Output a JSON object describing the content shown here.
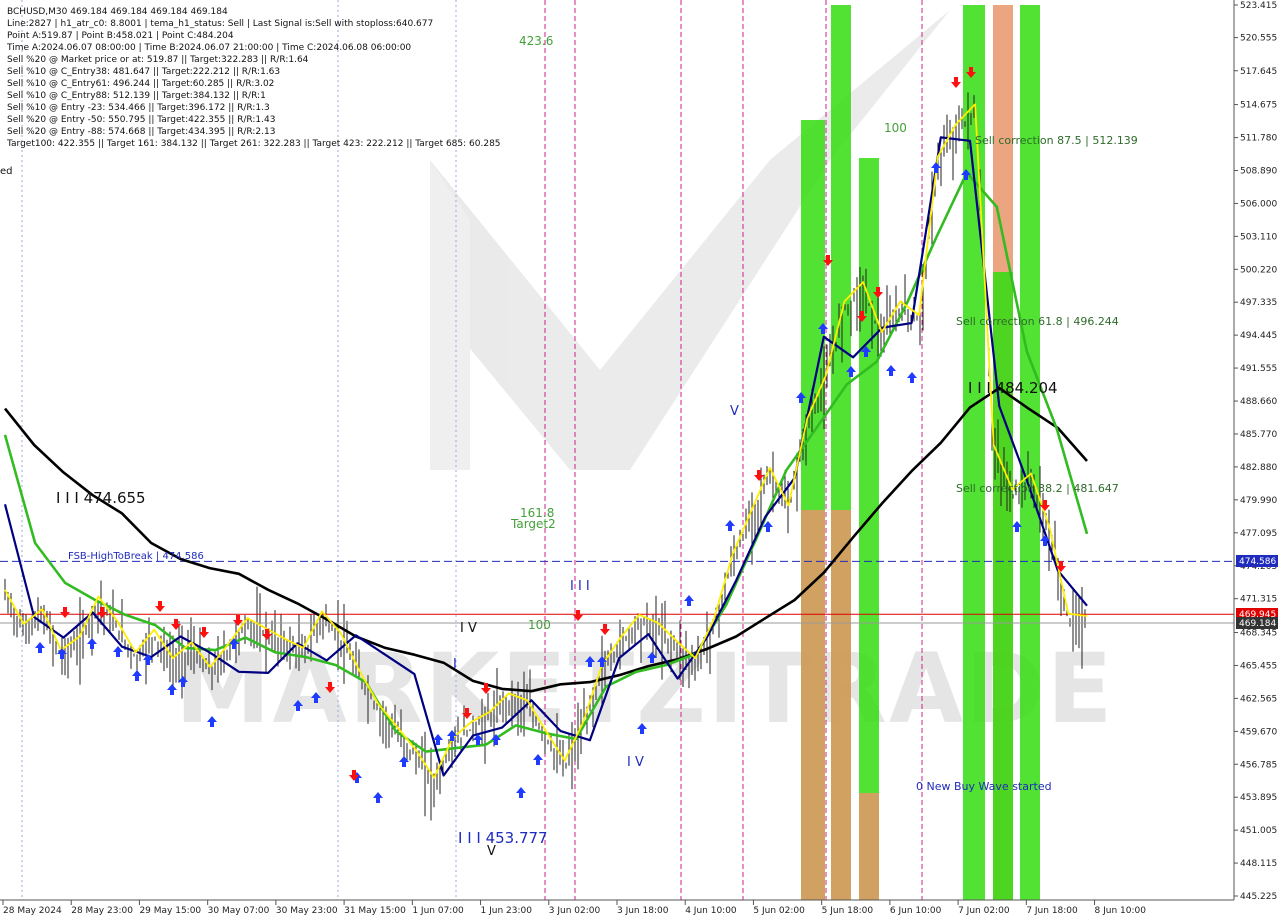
{
  "info_panel": {
    "lines": [
      "BCHUSD,M30  469.184 469.184 469.184 469.184",
      "Line:2827  |  h1_atr_c0: 8.8001  |  tema_h1_status: Sell  |  Last Signal is:Sell with stoploss:640.677",
      "Point A:519.87  |  Point B:458.021  |  Point C:484.204",
      "Time A:2024.06.07 08:00:00  |  Time B:2024.06.07 21:00:00  |  Time C:2024.06.08 06:00:00",
      "Sell %20 @ Market price or at: 519.87  ||  Target:322.283  ||  R/R:1.64",
      "Sell %10 @ C_Entry38: 481.647  ||  Target:222.212  ||  R/R:1.63",
      "Sell %10 @ C_Entry61: 496.244  ||  Target:60.285  ||  R/R:3.02",
      "Sell %10 @ C_Entry88: 512.139  ||  Target:384.132  ||  R/R:1",
      "Sell %10 @ Entry -23: 534.466  ||  Target:396.172  ||  R/R:1.3",
      "Sell %20 @ Entry -50: 550.795  ||  Target:422.355  ||  R/R:1.43",
      "Sell %20 @ Entry -88: 574.668  ||  Target:434.395  ||  R/R:2.13",
      "Target100: 422.355  ||  Target 161: 384.132  ||  Target 261: 322.283  ||  Target 423: 222.212  ||  Target 685: 60.285"
    ],
    "stray_label": "ed"
  },
  "annotations": {
    "fsb_label": "FSB-HighToBreak  |  474.586",
    "point_474": "I I I 474.655",
    "point_453": "I I I 453.777",
    "point_484": "I I I 484.204",
    "corr_875": "Sell correction 87.5 | 512.139",
    "corr_618": "Sell correction 61.8 | 496.244",
    "corr_382": "Sell correction 38.2 | 481.647",
    "buy_wave": "0 New Buy Wave started",
    "lvl_4236": "423.6",
    "lvl_1618": "161.8",
    "target2": "Target2",
    "lvl_100a": "100",
    "lvl_100b": "100",
    "wave_iv_top": "I V",
    "wave_iv_bottom": "I V",
    "wave_iii": "I I I",
    "wave_v_top": "V",
    "wave_v_bottom": "V",
    "wave_i": "I",
    "watermark": "MARKETZITRADE"
  },
  "price_tags": {
    "fsb": "474.586",
    "red_level": "469.945",
    "current": "469.184"
  },
  "colors": {
    "bg": "#ffffff",
    "fsb_line": "#1f2bbd",
    "red_level": "#e00000",
    "current_tag": "#333333",
    "green_bar": "#33dd11",
    "orange_bar": "#e8956a",
    "tema_black": "#000000",
    "tema_green": "#33bb22",
    "tema_navy": "#000080",
    "tema_yellow": "#ffee00",
    "buy_arrow": "#1f3bff",
    "sell_arrow": "#ff1010",
    "vline": "#cc2288",
    "text_green": "#44a03a"
  },
  "chart_data": {
    "type": "line",
    "symbol": "BCHUSD",
    "timeframe": "M30",
    "y_axis": {
      "min": 445.225,
      "max": 523.415,
      "ticks": [
        "523.415",
        "520.555",
        "517.645",
        "514.675",
        "511.780",
        "508.890",
        "506.000",
        "503.110",
        "500.220",
        "497.335",
        "494.445",
        "491.555",
        "488.660",
        "485.770",
        "482.880",
        "479.990",
        "477.095",
        "474.205",
        "471.315",
        "468.345",
        "465.455",
        "462.565",
        "459.670",
        "456.785",
        "453.895",
        "451.005",
        "448.115",
        "445.225"
      ]
    },
    "x_axis": {
      "ticks": [
        "28 May 2024",
        "28 May 23:00",
        "29 May 15:00",
        "30 May 07:00",
        "30 May 23:00",
        "31 May 15:00",
        "1 Jun 07:00",
        "1 Jun 23:00",
        "3 Jun 02:00",
        "3 Jun 18:00",
        "4 Jun 10:00",
        "5 Jun 02:00",
        "5 Jun 18:00",
        "6 Jun 10:00",
        "7 Jun 02:00",
        "7 Jun 18:00",
        "8 Jun 10:00"
      ]
    },
    "levels": {
      "fsb_high_to_break": 474.586,
      "red_level": 469.945,
      "current_price": 469.184,
      "point_a": 519.87,
      "point_b": 458.021,
      "point_c": 484.204
    },
    "series": [
      {
        "name": "close",
        "color": "#000000",
        "values": [
          471.5,
          468.5,
          469.8,
          466.2,
          467.4,
          470.9,
          468.8,
          466.0,
          468.0,
          465.5,
          466.9,
          464.7,
          466.8,
          469.0,
          468.1,
          467.2,
          466.4,
          469.6,
          467.7,
          464.4,
          461.5,
          459.5,
          457.5,
          455.0,
          458.5,
          459.9,
          460.8,
          462.4,
          461.8,
          459.1,
          456.5,
          459.9,
          464.9,
          467.3,
          469.3,
          468.6,
          467.0,
          465.5,
          468.9,
          474.6,
          478.4,
          482.2,
          478.9,
          486.5,
          490.3,
          496.8,
          498.5,
          494.1,
          496.8,
          495.6,
          509.5,
          512.4,
          514.1,
          484.2,
          480.3,
          481.7,
          476.9,
          469.4,
          469.2
        ]
      },
      {
        "name": "ema_slow",
        "color": "#000000",
        "values": [
          488.0,
          484.8,
          482.4,
          480.4,
          478.8,
          476.2,
          474.8,
          474.0,
          473.5,
          472.1,
          470.9,
          469.5,
          468.0,
          467.0,
          466.4,
          465.7,
          464.1,
          463.4,
          463.2,
          463.8,
          464.0,
          464.6,
          465.4,
          466.0,
          466.9,
          468.0,
          469.6,
          471.2,
          473.6,
          476.7,
          479.7,
          482.5,
          485.0,
          488.1,
          489.8,
          488.0,
          486.3,
          483.4
        ]
      },
      {
        "name": "ema_mid",
        "color": "#33bb22",
        "values": [
          485.7,
          476.2,
          472.7,
          471.2,
          469.9,
          469.0,
          467.0,
          466.8,
          467.9,
          466.6,
          466.2,
          465.5,
          464.0,
          459.7,
          457.9,
          458.2,
          458.5,
          460.2,
          459.5,
          459.0,
          463.6,
          464.9,
          465.5,
          466.5,
          470.8,
          476.6,
          482.6,
          486.3,
          490.1,
          492.1,
          497.2,
          503.1,
          508.7,
          505.7,
          493.0,
          486.2,
          477.0
        ]
      },
      {
        "name": "ema_fast",
        "color": "#000080",
        "values": [
          479.6,
          469.7,
          467.9,
          470.1,
          467.1,
          466.2,
          468.0,
          466.6,
          464.9,
          464.8,
          467.4,
          465.9,
          468.1,
          466.4,
          464.7,
          455.8,
          459.3,
          460.0,
          462.4,
          459.7,
          458.9,
          466.1,
          468.2,
          464.3,
          467.9,
          472.9,
          478.5,
          481.9,
          494.3,
          492.5,
          495.1,
          495.5,
          511.8,
          511.5,
          488.2,
          481.3,
          473.8,
          470.7
        ]
      }
    ]
  }
}
